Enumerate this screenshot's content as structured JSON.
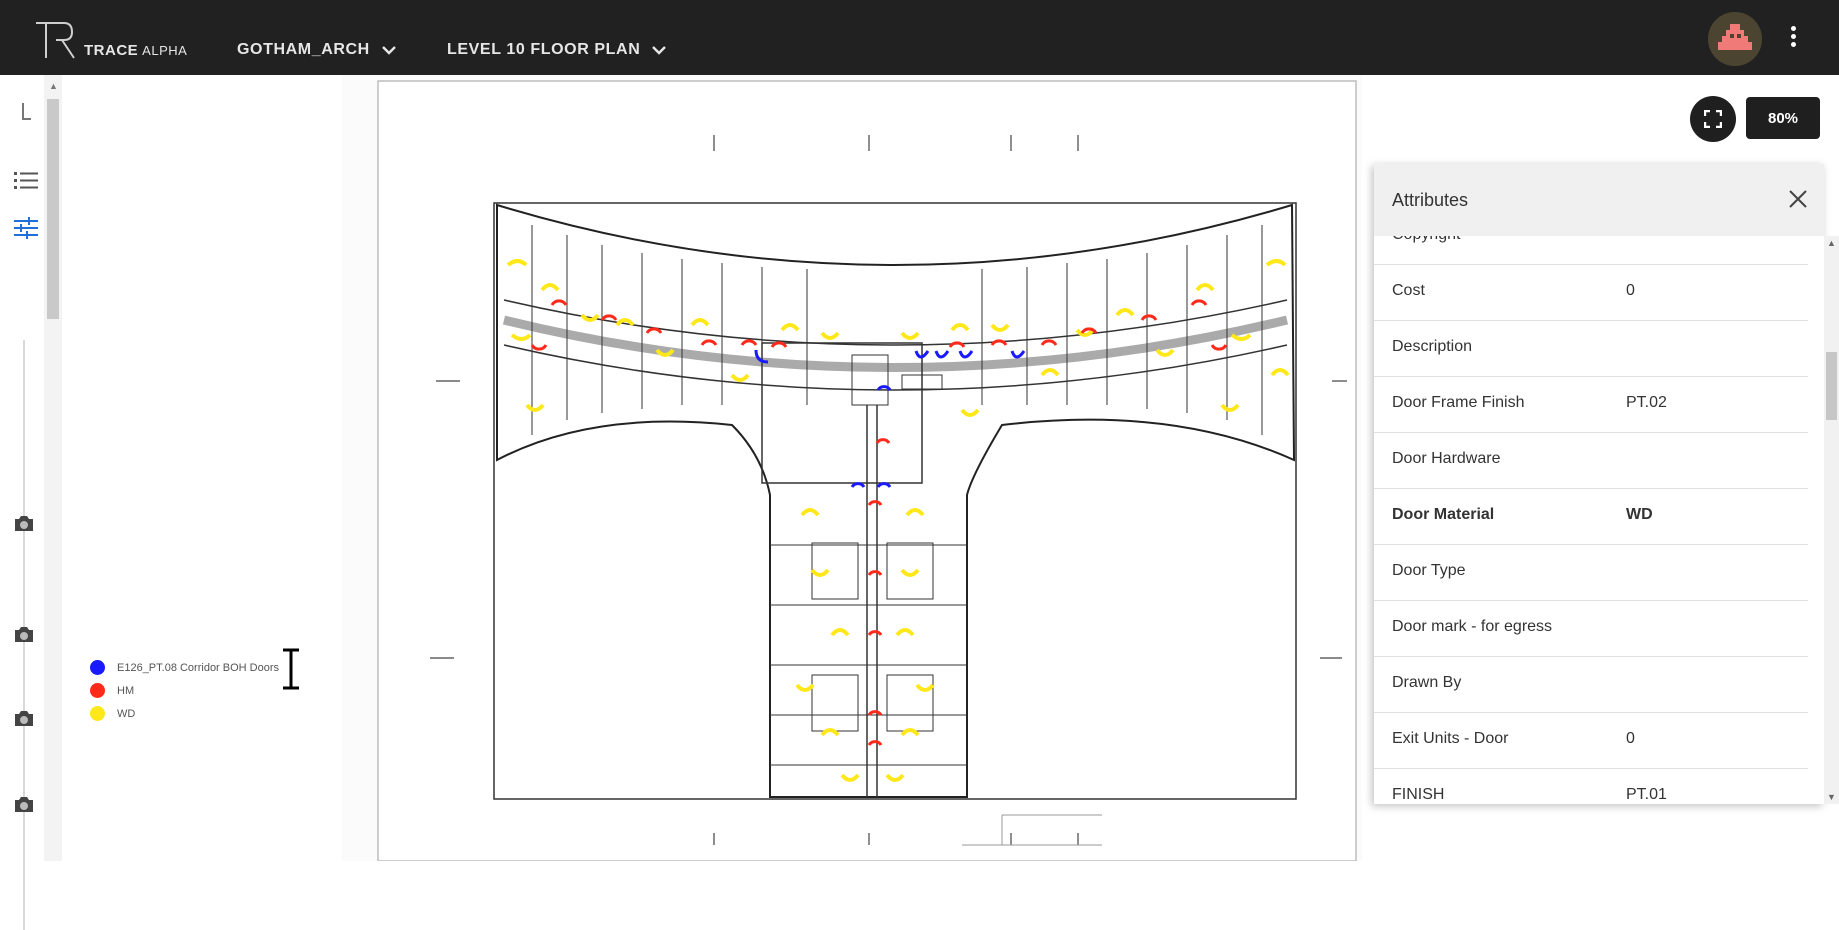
{
  "app": {
    "brand": "TRACE",
    "brand_suffix": "ALPHA",
    "project": "GOTHAM_ARCH",
    "sheet": "LEVEL 10 FLOOR PLAN"
  },
  "zoom": "80%",
  "legend": [
    {
      "label": "E126_PT.08 Corridor BOH Doors",
      "color": "#1a1aff"
    },
    {
      "label": "HM",
      "color": "#ff2a1a"
    },
    {
      "label": "WD",
      "color": "#ffe81a"
    }
  ],
  "attributes": {
    "title": "Attributes",
    "rows": [
      {
        "key": "Copyright",
        "value": ""
      },
      {
        "key": "Cost",
        "value": "0"
      },
      {
        "key": "Description",
        "value": ""
      },
      {
        "key": "Door Frame Finish",
        "value": "PT.02"
      },
      {
        "key": "Door Hardware",
        "value": ""
      },
      {
        "key": "Door Material",
        "value": "WD"
      },
      {
        "key": "Door Type",
        "value": ""
      },
      {
        "key": "Door mark - for egress",
        "value": ""
      },
      {
        "key": "Drawn By",
        "value": ""
      },
      {
        "key": "Exit Units - Door",
        "value": "0"
      },
      {
        "key": "FINISH",
        "value": "PT.01"
      }
    ]
  },
  "colors": {
    "topbar": "#212121",
    "door_blue": "#1a1aff",
    "door_red": "#ff2a1a",
    "door_yellow": "#ffe81a"
  },
  "icons": [
    "page-icon",
    "list-icon",
    "sliders-icon",
    "camera-icon",
    "chevron-down-icon",
    "fit-screen-icon",
    "close-icon",
    "kebab-menu-icon"
  ]
}
